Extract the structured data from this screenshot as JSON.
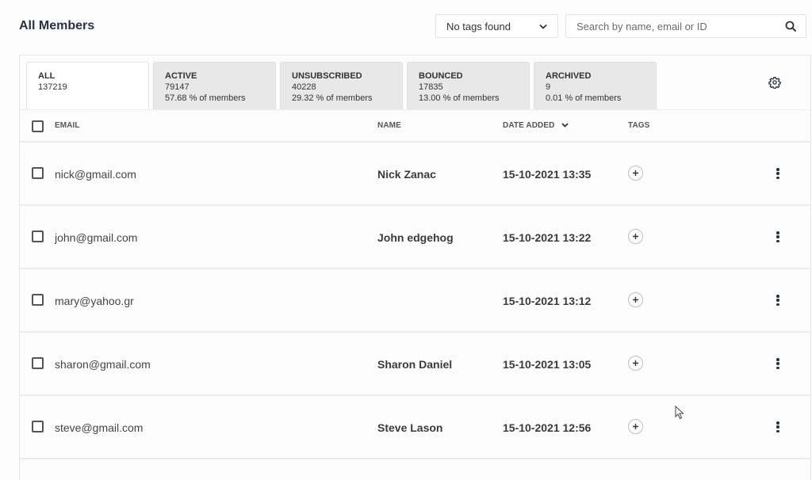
{
  "header": {
    "title": "All Members",
    "tag_filter": {
      "selected": "No tags found",
      "icon": "chevron-down-icon"
    },
    "search": {
      "placeholder": "Search by name, email or ID",
      "value": "",
      "icon": "search-icon"
    }
  },
  "tabs": [
    {
      "title": "ALL",
      "count": "137219",
      "percent": "",
      "active": true
    },
    {
      "title": "ACTIVE",
      "count": "79147",
      "percent": "57.68 % of members",
      "active": false
    },
    {
      "title": "UNSUBSCRIBED",
      "count": "40228",
      "percent": "29.32 % of members",
      "active": false
    },
    {
      "title": "BOUNCED",
      "count": "17835",
      "percent": "13.00 % of members",
      "active": false
    },
    {
      "title": "ARCHIVED",
      "count": "9",
      "percent": "0.01 % of members",
      "active": false
    }
  ],
  "settings_icon": "gear-icon",
  "table": {
    "columns": {
      "email": "EMAIL",
      "name": "NAME",
      "date_added": "DATE ADDED",
      "tags": "TAGS"
    },
    "sort": {
      "column": "date_added",
      "direction": "desc"
    },
    "rows": [
      {
        "email": "nick@gmail.com",
        "name": "Nick Zanac",
        "date_added": "15-10-2021 13:35",
        "tags": []
      },
      {
        "email": "john@gmail.com",
        "name": "John edgehog",
        "date_added": "15-10-2021 13:22",
        "tags": []
      },
      {
        "email": "mary@yahoo.gr",
        "name": "",
        "date_added": "15-10-2021 13:12",
        "tags": []
      },
      {
        "email": "sharon@gmail.com",
        "name": "Sharon Daniel",
        "date_added": "15-10-2021 13:05",
        "tags": []
      },
      {
        "email": "steve@gmail.com",
        "name": "Steve Lason",
        "date_added": "15-10-2021 12:56",
        "tags": []
      }
    ]
  },
  "colors": {
    "title_text": "#2c3140",
    "tab_inactive_bg": "#e8e8e8",
    "tab_active_bg": "#ffffff",
    "divider": "#ececec"
  }
}
